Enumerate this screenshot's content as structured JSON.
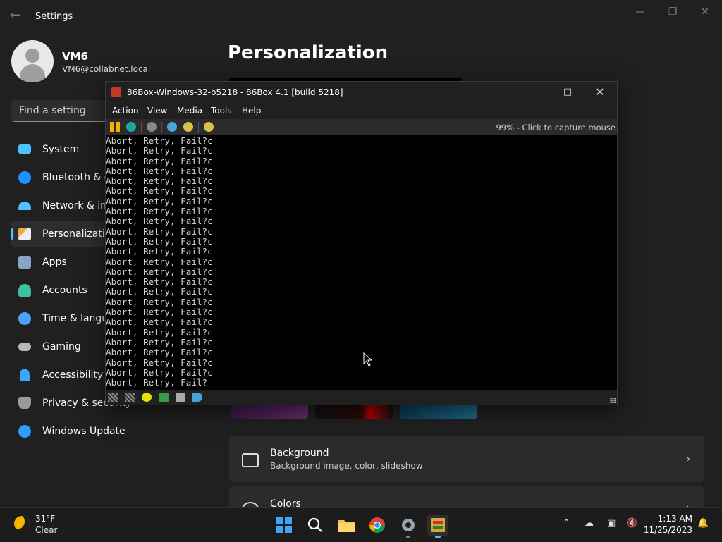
{
  "settings": {
    "window_title": "Settings",
    "user": {
      "name": "VM6",
      "email": "VM6@collabnet.local"
    },
    "search_placeholder": "Find a setting",
    "nav": [
      {
        "label": "System",
        "icon": "monitor-icon",
        "color": "#4cc2ff"
      },
      {
        "label": "Bluetooth & devices",
        "icon": "bluetooth-icon",
        "color": "#1e90ff"
      },
      {
        "label": "Network & internet",
        "icon": "wifi-icon",
        "color": "#4cc2ff"
      },
      {
        "label": "Personalization",
        "icon": "brush-icon",
        "color": "#f0a848",
        "selected": true
      },
      {
        "label": "Apps",
        "icon": "apps-icon",
        "color": "#8aa4c8"
      },
      {
        "label": "Accounts",
        "icon": "person-icon",
        "color": "#3fc1a0"
      },
      {
        "label": "Time & language",
        "icon": "clock-globe-icon",
        "color": "#4ca3ff"
      },
      {
        "label": "Gaming",
        "icon": "gamepad-icon",
        "color": "#b8b8b8"
      },
      {
        "label": "Accessibility",
        "icon": "accessibility-icon",
        "color": "#3aa7ff"
      },
      {
        "label": "Privacy & security",
        "icon": "shield-icon",
        "color": "#9a9a9a"
      },
      {
        "label": "Windows Update",
        "icon": "update-icon",
        "color": "#2f9bff"
      }
    ],
    "page_title": "Personalization",
    "cards": [
      {
        "title": "Background",
        "subtitle": "Background image, color, slideshow"
      },
      {
        "title": "Colors",
        "subtitle": ""
      }
    ]
  },
  "box86": {
    "title": "86Box-Windows-32-b5218 - 86Box 4.1 [build 5218]",
    "menu": [
      "Action",
      "View",
      "Media",
      "Tools",
      "Help"
    ],
    "status": "99% - Click to capture mouse",
    "screen_lines": [
      "Abort, Retry, Fail?c",
      "Abort, Retry, Fail?c",
      "Abort, Retry, Fail?c",
      "Abort, Retry, Fail?c",
      "Abort, Retry, Fail?c",
      "Abort, Retry, Fail?c",
      "Abort, Retry, Fail?c",
      "Abort, Retry, Fail?c",
      "Abort, Retry, Fail?c",
      "Abort, Retry, Fail?c",
      "Abort, Retry, Fail?c",
      "Abort, Retry, Fail?c",
      "Abort, Retry, Fail?c",
      "Abort, Retry, Fail?c",
      "Abort, Retry, Fail?c",
      "Abort, Retry, Fail?c",
      "Abort, Retry, Fail?c",
      "Abort, Retry, Fail?c",
      "Abort, Retry, Fail?c",
      "Abort, Retry, Fail?c",
      "Abort, Retry, Fail?c",
      "Abort, Retry, Fail?c",
      "Abort, Retry, Fail?c",
      "Abort, Retry, Fail?c",
      "Abort, Retry, Fail?"
    ]
  },
  "taskbar": {
    "weather": {
      "temp": "31°F",
      "condition": "Clear"
    },
    "time": "1:13 AM",
    "date": "11/25/2023"
  },
  "colors": {
    "accent": "#4cc2ff",
    "desktop_bg": "#202020",
    "screen_bg": "#000000"
  }
}
